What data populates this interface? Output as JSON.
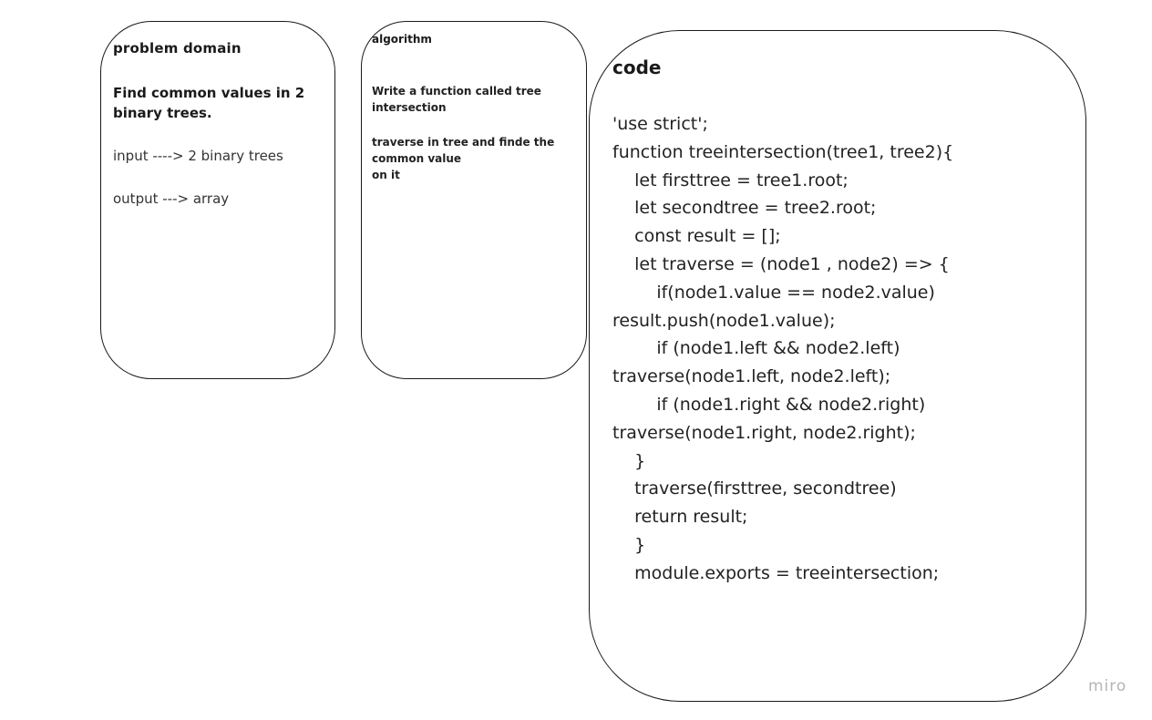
{
  "problem_card": {
    "title": "problem domain",
    "heading": "Find common values in 2 binary trees.",
    "input_line": "input ----> 2 binary trees",
    "output_line": "output ---> array"
  },
  "algorithm_card": {
    "title": "algorithm",
    "text_1": "Write a function called tree intersection",
    "text_2": "traverse in tree and finde the common value\non it"
  },
  "code_card": {
    "title": "code",
    "lines": [
      "'use strict';",
      "function treeintersection(tree1, tree2){",
      "    let firsttree = tree1.root;",
      "    let secondtree = tree2.root;",
      "    const result = [];",
      "    let traverse = (node1 , node2) => {",
      "        if(node1.value == node2.value)",
      "result.push(node1.value);",
      "        if (node1.left && node2.left)",
      "traverse(node1.left, node2.left);",
      "        if (node1.right && node2.right)",
      "traverse(node1.right, node2.right);",
      "    }",
      "    traverse(firsttree, secondtree)",
      "    return result;",
      "    }",
      "    module.exports = treeintersection;"
    ]
  },
  "watermark": "miro"
}
